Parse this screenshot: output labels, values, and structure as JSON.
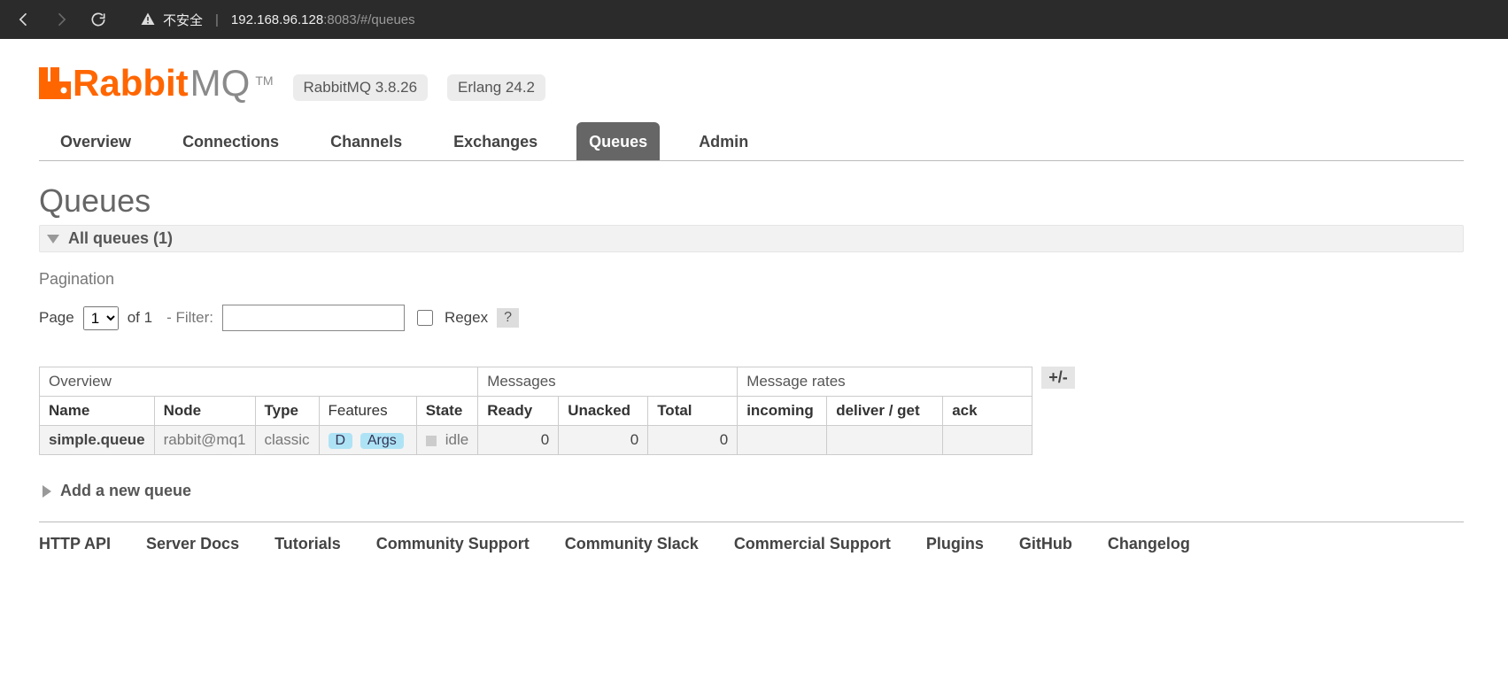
{
  "browser": {
    "insecure_label": "不安全",
    "host": "192.168.96.128",
    "port_path": ":8083/#/queues"
  },
  "header": {
    "brand_first": "Rabbit",
    "brand_second": "MQ",
    "tm": "TM",
    "version_badge": "RabbitMQ 3.8.26",
    "erlang_badge": "Erlang 24.2"
  },
  "tabs": {
    "overview": "Overview",
    "connections": "Connections",
    "channels": "Channels",
    "exchanges": "Exchanges",
    "queues": "Queues",
    "admin": "Admin"
  },
  "page_title": "Queues",
  "sections": {
    "all_queues": "All queues (1)",
    "pagination_label": "Pagination",
    "add_new_queue": "Add a new queue"
  },
  "pager": {
    "page_label": "Page",
    "page_value": "1",
    "of_label": "of 1",
    "filter_label": "- Filter:",
    "filter_value": "",
    "regex_label": "Regex",
    "help": "?"
  },
  "table": {
    "groups": {
      "overview": "Overview",
      "messages": "Messages",
      "rates": "Message rates"
    },
    "cols": {
      "name": "Name",
      "node": "Node",
      "type": "Type",
      "features": "Features",
      "state": "State",
      "ready": "Ready",
      "unacked": "Unacked",
      "total": "Total",
      "incoming": "incoming",
      "deliver_get": "deliver / get",
      "ack": "ack"
    },
    "row": {
      "name": "simple.queue",
      "node": "rabbit@mq1",
      "type": "classic",
      "feat_d": "D",
      "feat_args": "Args",
      "state": "idle",
      "ready": "0",
      "unacked": "0",
      "total": "0",
      "incoming": "",
      "deliver_get": "",
      "ack": ""
    },
    "plusminus": "+/-"
  },
  "footer": {
    "http_api": "HTTP API",
    "server_docs": "Server Docs",
    "tutorials": "Tutorials",
    "community_support": "Community Support",
    "community_slack": "Community Slack",
    "commercial_support": "Commercial Support",
    "plugins": "Plugins",
    "github": "GitHub",
    "changelog": "Changelog"
  }
}
